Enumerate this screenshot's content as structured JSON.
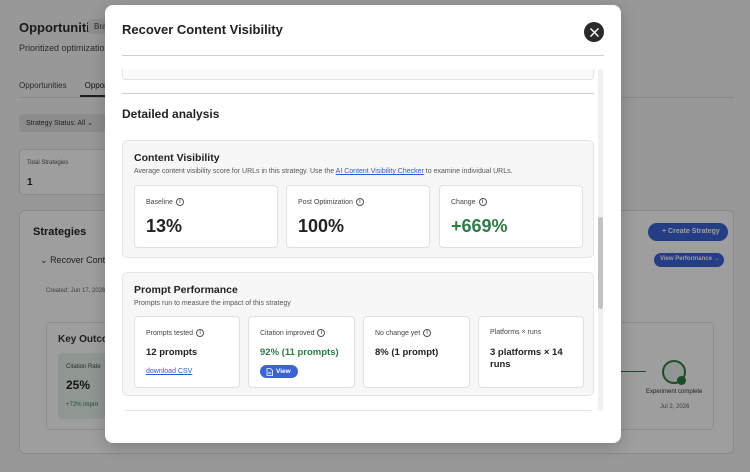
{
  "background": {
    "page_title": "Opportunities",
    "badge": "Bra",
    "subtitle": "Prioritized optimization",
    "tabs": [
      "Opportunities",
      "Opportu"
    ],
    "filter": "Strategy Status: All",
    "total_strategies_label": "Total Strategies",
    "total_strategies_value": "1",
    "strategies_title": "Strategies",
    "strategy_name": "Recover Conte",
    "created": "Created: Jun 17, 2026",
    "create_strategy_button": "Create Strategy",
    "view_performance_button": "View Performance →",
    "key_outcomes_title": "Key Outco",
    "citation_label": "Citation Rate",
    "citation_value": "25%",
    "citation_improvement": "+72% impro",
    "experiment_status": "Experiment complete",
    "experiment_date": "Jul 2, 2026"
  },
  "modal": {
    "title": "Recover Content Visibility",
    "detailed_title": "Detailed analysis",
    "content_visibility": {
      "title": "Content Visibility",
      "desc_before": "Average content visibility score for URLs in this strategy. Use the ",
      "desc_link": "AI Content Visibility Checker",
      "desc_after": " to examine individual URLs.",
      "metrics": [
        {
          "label": "Baseline",
          "value": "13%"
        },
        {
          "label": "Post Optimization",
          "value": "100%"
        },
        {
          "label": "Change",
          "value": "+669%"
        }
      ]
    },
    "prompt_performance": {
      "title": "Prompt Performance",
      "desc": "Prompts run to measure the impact of this strategy",
      "prompts_tested_label": "Prompts tested",
      "prompts_tested_value": "12 prompts",
      "download_label": "download CSV",
      "citation_improved_label": "Citation improved",
      "citation_improved_value": "92% (11 prompts)",
      "view_label": "View",
      "no_change_label": "No change yet",
      "no_change_value": "8% (1 prompt)",
      "platforms_label": "Platforms × runs",
      "platforms_value": "3 platforms × 14 runs"
    }
  },
  "colors": {
    "accent": "#3b63d6",
    "positive": "#2d7d46",
    "link": "#2a5bd7"
  }
}
